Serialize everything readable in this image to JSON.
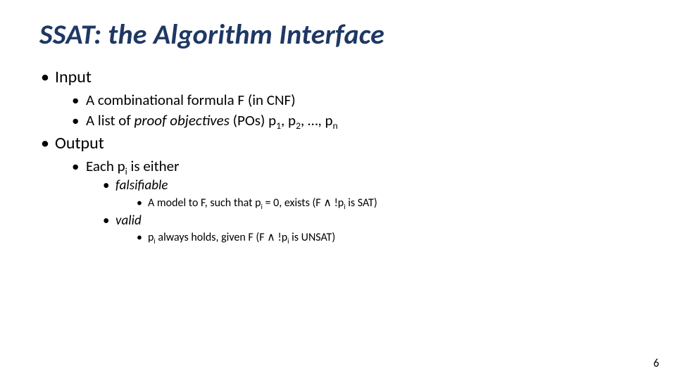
{
  "title": "SSAT: the Algorithm Interface",
  "bullets": {
    "input": {
      "label": "Input",
      "items": {
        "formula": "A combinational formula F (in CNF)",
        "po_prefix": "A list of ",
        "po_ital": "proof objectives",
        "po_mid": " (POs) p",
        "po_s1": "1",
        "po_sep1": ", p",
        "po_s2": "2",
        "po_sep2": ", …, p",
        "po_sn": "n"
      }
    },
    "output": {
      "label": "Output",
      "each_prefix": "Each p",
      "each_sub": "i",
      "each_suffix": " is either",
      "falsifiable": {
        "label": "falsifiable",
        "detail_prefix": "A model to F, such that p",
        "detail_sub": "i",
        "detail_mid": " = 0, exists (F ∧ !p",
        "detail_sub2": "i",
        "detail_suffix": " is SAT)"
      },
      "valid": {
        "label": "valid",
        "detail_prefix": "p",
        "detail_sub": "i",
        "detail_mid": " always holds, given F (F ∧ !p",
        "detail_sub2": "i",
        "detail_suffix": " is UNSAT)"
      }
    }
  },
  "page_number": "6"
}
